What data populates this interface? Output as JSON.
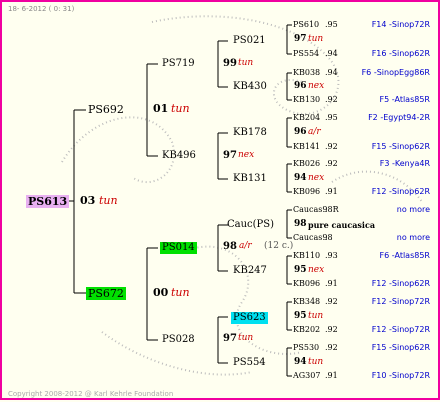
{
  "header": "18-  6-2012 (  0: 31)",
  "footer": "Copyright 2008-2012 @ Karl Kehrle Foundation",
  "root": {
    "id": "PS613",
    "year": "03",
    "race": "tun"
  },
  "gen2": [
    {
      "id": "PS692"
    },
    {
      "id": "PS672"
    }
  ],
  "gen2_years": [
    {
      "year": "01",
      "race": "tun"
    },
    {
      "year": "00",
      "race": "tun"
    }
  ],
  "gen3": [
    {
      "id": "PS719",
      "year": "99",
      "race": "tun"
    },
    {
      "id": "KB496",
      "year": "97",
      "race": "nex"
    },
    {
      "id": "PS014",
      "year": "98",
      "race": "a/r",
      "note": "(12 c.)"
    },
    {
      "id": "PS028",
      "year": "97",
      "race": "tun"
    }
  ],
  "gen4": [
    {
      "id": "PS021"
    },
    {
      "id": "KB430"
    },
    {
      "id": "KB178",
      "year": "96",
      "race": "a/r"
    },
    {
      "id": "KB131",
      "year": "94",
      "race": "nex"
    },
    {
      "id": "Cauc(PS)",
      "year": "98",
      "race": "pure caucasica"
    },
    {
      "id": "KB247",
      "year": "95",
      "race": "nex"
    },
    {
      "id": "PS623",
      "year": "95",
      "race": "tun"
    },
    {
      "id": "PS554",
      "year": "94",
      "race": "tun"
    }
  ],
  "gen4_years": [
    {
      "year": "97",
      "race": "tun"
    },
    {
      "year": "96",
      "race": "nex"
    }
  ],
  "gen5": [
    {
      "id": "PS610",
      "yr": ".95",
      "dest": "F14 -Sinop72R"
    },
    {
      "id": "PS554",
      "yr": ".94",
      "dest": "F16 -Sinop62R"
    },
    {
      "id": "KB038",
      "yr": ".94",
      "dest": "F6 -SinopEgg86R"
    },
    {
      "id": "KB130",
      "yr": ".92",
      "dest": "F5 -Atlas85R"
    },
    {
      "id": "KB204",
      "yr": ".95",
      "dest": "F2 -Egypt94-2R"
    },
    {
      "id": "KB141",
      "yr": ".92",
      "dest": "F15 -Sinop62R"
    },
    {
      "id": "KB026",
      "yr": ".92",
      "dest": "F3 -Kenya4R"
    },
    {
      "id": "KB096",
      "yr": ".91",
      "dest": "F12 -Sinop62R"
    },
    {
      "id": "Caucas98R",
      "yr": ".",
      "dest": "no more"
    },
    {
      "id": "Caucas98",
      "yr": ".",
      "dest": "no more"
    },
    {
      "id": "KB110",
      "yr": ".93",
      "dest": "F6 -Atlas85R"
    },
    {
      "id": "KB096",
      "yr": ".91",
      "dest": "F12 -Sinop62R"
    },
    {
      "id": "KB348",
      "yr": ".92",
      "dest": "F12 -Sinop72R"
    },
    {
      "id": "KB202",
      "yr": ".92",
      "dest": "F12 -Sinop72R"
    },
    {
      "id": "PS530",
      "yr": ".92",
      "dest": "F15 -Sinop62R"
    },
    {
      "id": "AG307",
      "yr": ".91",
      "dest": "F10 -Sinop72R"
    }
  ]
}
